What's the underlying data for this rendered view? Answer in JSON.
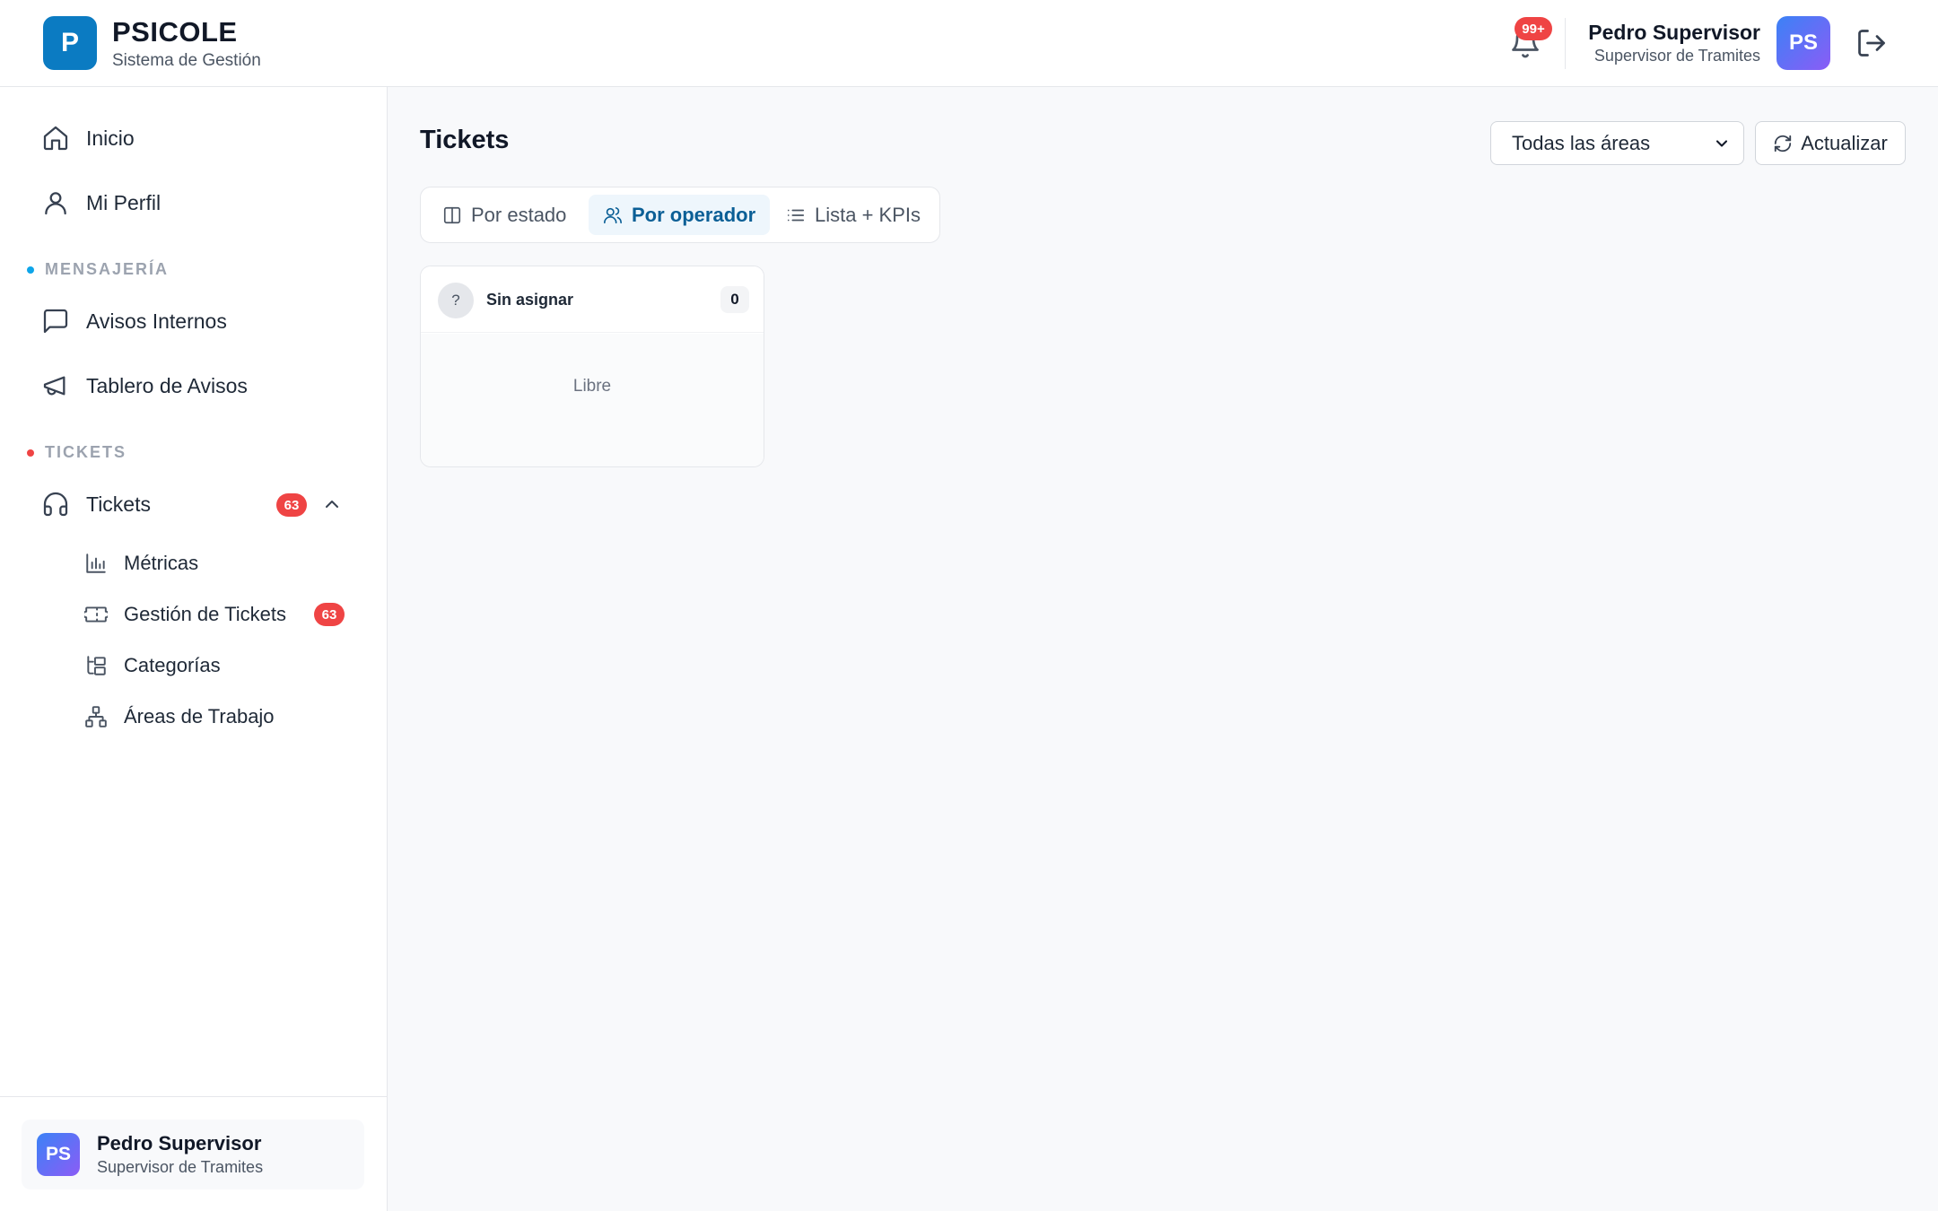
{
  "header": {
    "logo_letter": "P",
    "brand_name": "PSICOLE",
    "brand_subtitle": "Sistema de Gestión",
    "notifications_badge": "99+",
    "user_name": "Pedro Supervisor",
    "user_role": "Supervisor de Tramites",
    "user_initials": "PS"
  },
  "sidebar": {
    "top_items": [
      {
        "label": "Inicio",
        "icon": "home-icon"
      },
      {
        "label": "Mi Perfil",
        "icon": "user-icon"
      }
    ],
    "sections": [
      {
        "label": "MENSAJERÍA",
        "dot_color": "#0ea5e9",
        "items": [
          {
            "label": "Avisos Internos",
            "icon": "message-square-icon"
          },
          {
            "label": "Tablero de Avisos",
            "icon": "megaphone-icon"
          }
        ]
      },
      {
        "label": "TICKETS",
        "dot_color": "#ef4444",
        "items": [
          {
            "label": "Tickets",
            "icon": "headphones-icon",
            "badge": "63",
            "expanded": true
          }
        ]
      }
    ],
    "sub_items": [
      {
        "label": "Métricas",
        "icon": "bar-chart-icon"
      },
      {
        "label": "Gestión de Tickets",
        "icon": "ticket-icon",
        "badge": "63"
      },
      {
        "label": "Categorías",
        "icon": "folder-tree-icon"
      },
      {
        "label": "Áreas de Trabajo",
        "icon": "network-icon"
      }
    ],
    "user_card": {
      "initials": "PS",
      "name": "Pedro Supervisor",
      "role": "Supervisor de Tramites"
    }
  },
  "main": {
    "title": "Tickets",
    "area_filter": {
      "selected": "Todas las áreas"
    },
    "refresh_label": "Actualizar",
    "tabs": [
      {
        "label": "Por estado",
        "icon": "columns-icon",
        "active": false
      },
      {
        "label": "Por operador",
        "icon": "users-icon",
        "active": true
      },
      {
        "label": "Lista + KPIs",
        "icon": "list-icon",
        "active": false
      }
    ],
    "operator_columns": [
      {
        "avatar": "?",
        "name": "Sin asignar",
        "count": "0",
        "empty_text": "Libre"
      }
    ]
  },
  "colors": {
    "brand": "#0b7bc2",
    "badge": "#ef4444",
    "active_tab_bg": "#eef6fc",
    "active_tab_text": "#0b5f96"
  }
}
